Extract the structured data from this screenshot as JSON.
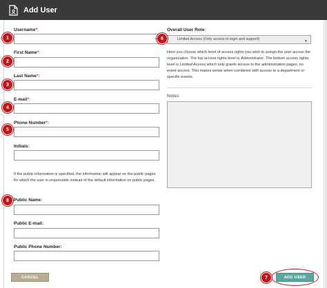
{
  "header": {
    "title": "Add User",
    "icon": "document-user-icon"
  },
  "form": {
    "username_label": "Username",
    "firstname_label": "First Name",
    "lastname_label": "Last Name",
    "email_label": "E-mail",
    "phone_label": "Phone Number",
    "initials_label": "Initials:",
    "required_mark": "*:",
    "public_info": "If the public information is specified, the information will appear on the public pages for which the user is responsible instead of the default information on public pages.",
    "public_name_label": "Public Name:",
    "public_email_label": "Public E-mail:",
    "public_phone_label": "Public Phone Number:"
  },
  "role": {
    "label": "Overall User Role:",
    "selected": "Limited Access (Only access to login and support)",
    "description": {
      "part1": "Here you choose which level of access rights you wish to assign the user across the organization. The top access rights level is ",
      "admin": "Administrator",
      "part2": ". The bottom access rights level is ",
      "limited": "Limited Access",
      "part3": " which only grants access to the administration pages, no event access. This makes sense when combined with access to a department or specific events."
    },
    "notes_label": "Notes:"
  },
  "buttons": {
    "cancel": "CANCEL",
    "add_user": "ADD USER"
  },
  "badges": [
    "1",
    "2",
    "3",
    "4",
    "5",
    "6",
    "7",
    "8"
  ],
  "colors": {
    "header_bg": "#3a3a3a",
    "badge": "#c0161b",
    "add_button": "#5fa59b",
    "cancel_button": "#b8ad92"
  }
}
